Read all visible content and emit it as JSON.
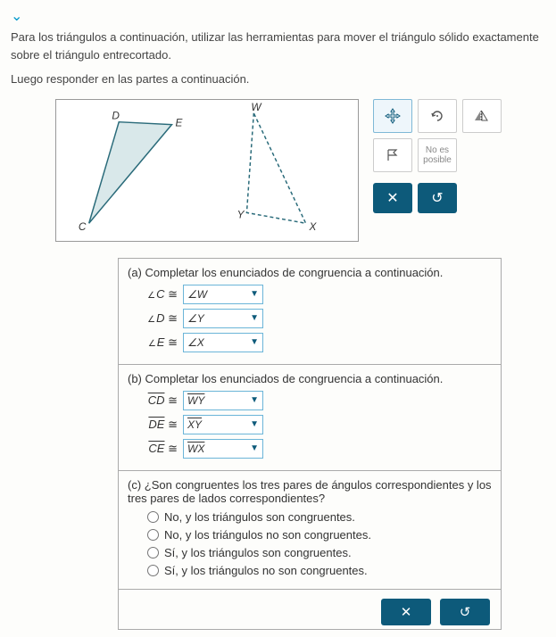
{
  "instructions": {
    "line1": "Para los triángulos a continuación, utilizar las herramientas para mover el triángulo sólido exactamente sobre el triángulo entrecortado.",
    "line2": "Luego responder en las partes a continuación."
  },
  "triangles": {
    "left": {
      "D": "D",
      "E": "E",
      "C": "C"
    },
    "right": {
      "W": "W",
      "Y": "Y",
      "X": "X"
    }
  },
  "tools": {
    "not_possible": "No es\nposible"
  },
  "parts": {
    "a": {
      "prompt": "(a) Completar los enunciados de congruencia a continuación.",
      "rows": [
        {
          "left": "C",
          "val": "∠W"
        },
        {
          "left": "D",
          "val": "∠Y"
        },
        {
          "left": "E",
          "val": "∠X"
        }
      ]
    },
    "b": {
      "prompt": "(b) Completar los enunciados de congruencia a continuación.",
      "rows": [
        {
          "left": "CD",
          "val": "WY"
        },
        {
          "left": "DE",
          "val": "XY"
        },
        {
          "left": "CE",
          "val": "WX"
        }
      ]
    },
    "c": {
      "prompt": "(c) ¿Son congruentes los tres pares de ángulos correspondientes y los tres pares de lados correspondientes?",
      "options": [
        "No, y los triángulos son congruentes.",
        "No, y los triángulos no son congruentes.",
        "Sí, y los triángulos son congruentes.",
        "Sí, y los triángulos no son congruentes."
      ]
    }
  },
  "symbols": {
    "cong": "≅"
  }
}
